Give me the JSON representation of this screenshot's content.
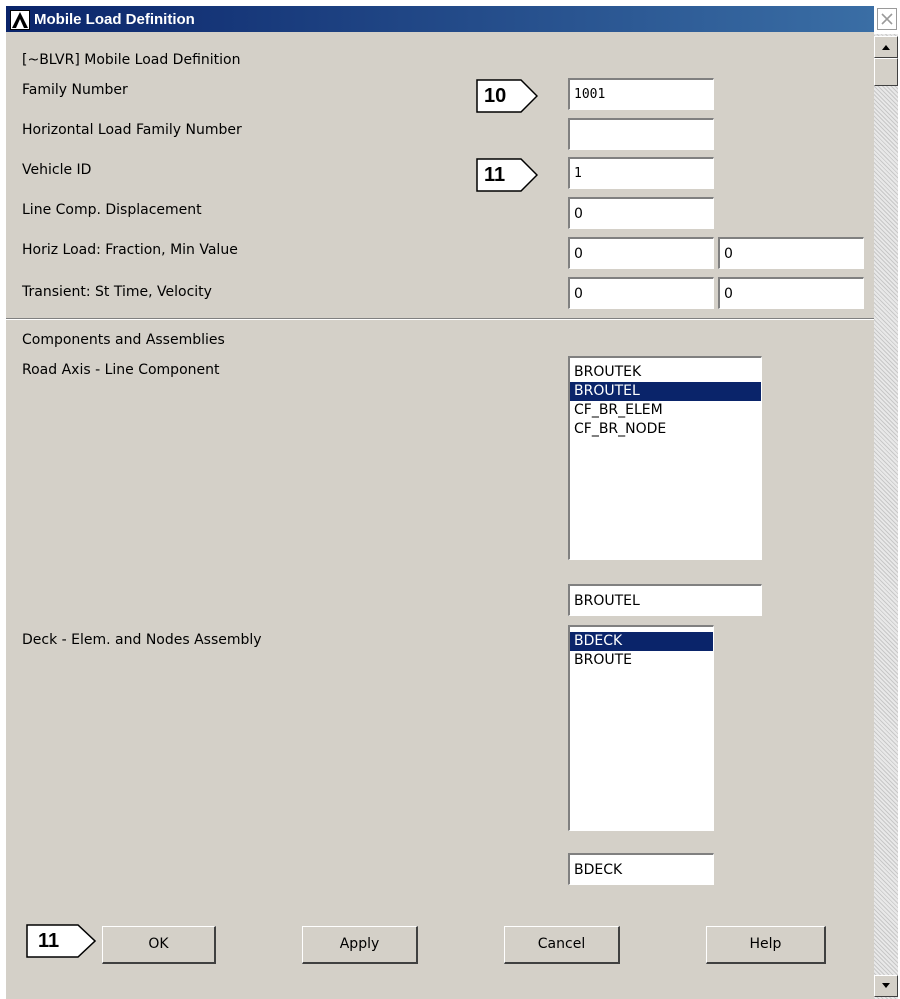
{
  "window": {
    "title": "Mobile Load Definition",
    "close_glyph": "×",
    "logo_icon": "ansys-logo-icon"
  },
  "header": {
    "command": "[~BLVR] Mobile Load Definition"
  },
  "fields": {
    "family_number": {
      "label": "Family Number",
      "value": "1001"
    },
    "horizontal_family": {
      "label": "Horizontal Load Family Number",
      "value": ""
    },
    "vehicle_id": {
      "label": "Vehicle ID",
      "value": "1"
    },
    "line_comp_disp": {
      "label": "Line Comp. Displacement",
      "value": "0"
    },
    "horiz_load": {
      "label": "Horiz Load: Fraction, Min Value",
      "value1": "0",
      "value2": "0"
    },
    "transient": {
      "label": "Transient: St Time, Velocity",
      "value1": "0",
      "value2": "0"
    }
  },
  "components": {
    "section_label": "Components and Assemblies",
    "road_axis": {
      "label": "Road Axis - Line Component",
      "items": [
        "BROUTEK",
        "BROUTEL",
        "CF_BR_ELEM",
        "CF_BR_NODE"
      ],
      "selected_index": 1,
      "selection": "BROUTEL"
    },
    "deck": {
      "label": "Deck - Elem. and Nodes Assembly",
      "items": [
        "BDECK",
        "BROUTE"
      ],
      "selected_index": 0,
      "selection": "BDECK"
    }
  },
  "buttons": {
    "ok": "OK",
    "apply": "Apply",
    "cancel": "Cancel",
    "help": "Help"
  },
  "callouts": {
    "family": "10",
    "vehicle": "11",
    "ok": "11"
  },
  "colors": {
    "title_bar": "#0a246a",
    "dialog_bg": "#d4d0c8",
    "selection": "#0a246a"
  }
}
